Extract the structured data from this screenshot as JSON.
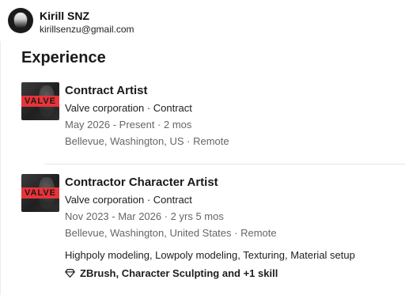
{
  "user": {
    "name": "Kirill SNZ",
    "email": "kirillsenzu@gmail.com"
  },
  "section": {
    "title": "Experience"
  },
  "experience": [
    {
      "logo_text": "VALVE",
      "title": "Contract Artist",
      "company": "Valve corporation · Contract",
      "dates": "May 2026 - Present · 2 mos",
      "location": "Bellevue, Washington, US · Remote"
    },
    {
      "logo_text": "VALVE",
      "title": "Contractor Character Artist",
      "company": "Valve corporation · Contract",
      "dates": "Nov 2023 - Mar 2026 · 2 yrs 5 mos",
      "location": "Bellevue, Washington, United States · Remote",
      "description": "Highpoly modeling, Lowpoly modeling, Texturing, Material setup",
      "skills": "ZBrush, Character Sculpting and +1 skill",
      "skills_icon": "diamond-icon"
    }
  ],
  "colors": {
    "logo_band": "#e8333a",
    "muted_text": "#666666",
    "divider": "#e3e3e3"
  }
}
